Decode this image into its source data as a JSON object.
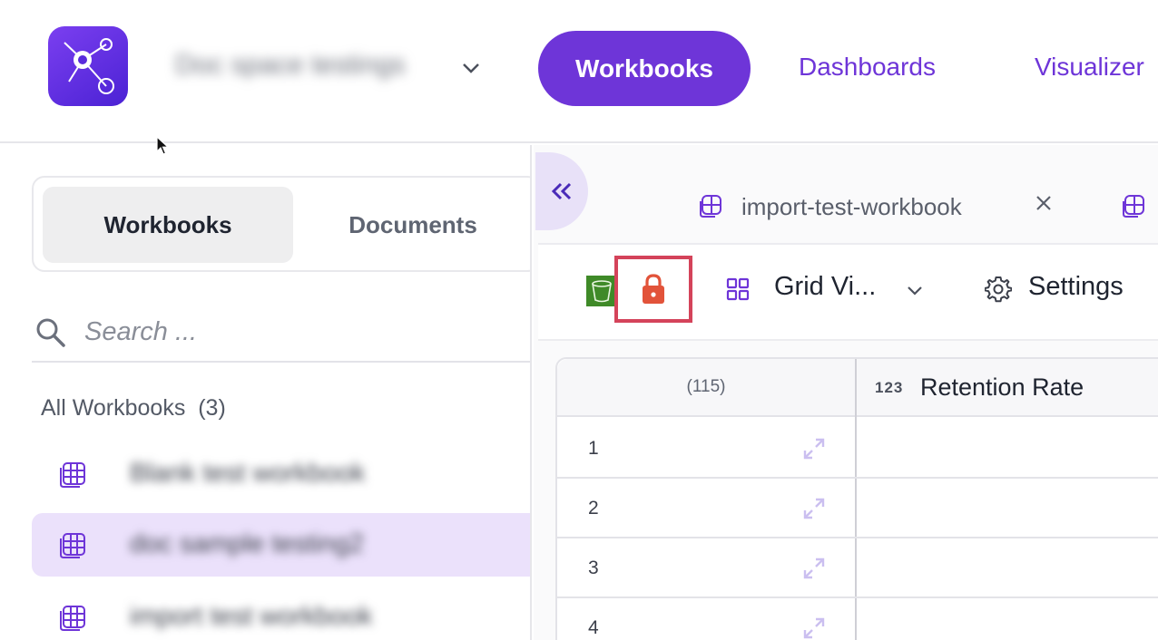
{
  "header": {
    "space_name": "Doc space testings",
    "nav": {
      "active": "Workbooks",
      "items": [
        "Dashboards",
        "Visualizer"
      ]
    }
  },
  "sidebar": {
    "segments": [
      "Workbooks",
      "Documents"
    ],
    "search_placeholder": "Search ...",
    "section_title": "All Workbooks",
    "section_count": "(3)",
    "workbooks": [
      {
        "label": "Blank test workbook",
        "selected": false
      },
      {
        "label": "doc sample testing2",
        "selected": true
      },
      {
        "label": "import test workbook",
        "selected": false
      }
    ]
  },
  "main": {
    "tab": {
      "label": "import-test-workbook"
    },
    "toolbar": {
      "view_label": "Grid Vi...",
      "settings_label": "Settings"
    },
    "table": {
      "record_count": "(115)",
      "column_type": "123",
      "column_name": "Retention Rate",
      "rows": [
        "1",
        "2",
        "3",
        "4"
      ]
    }
  },
  "colors": {
    "accent": "#6e35d8",
    "lock": "#e2533a",
    "highlight_border": "#d4435a",
    "selected_row": "#ebe1fb"
  },
  "icons": {
    "logo": "network-graph-icon",
    "search": "search-icon",
    "workbook": "table-grid-icon",
    "lock": "lock-icon",
    "view": "grid-view-icon",
    "settings": "gear-icon",
    "expand": "expand-icon"
  }
}
